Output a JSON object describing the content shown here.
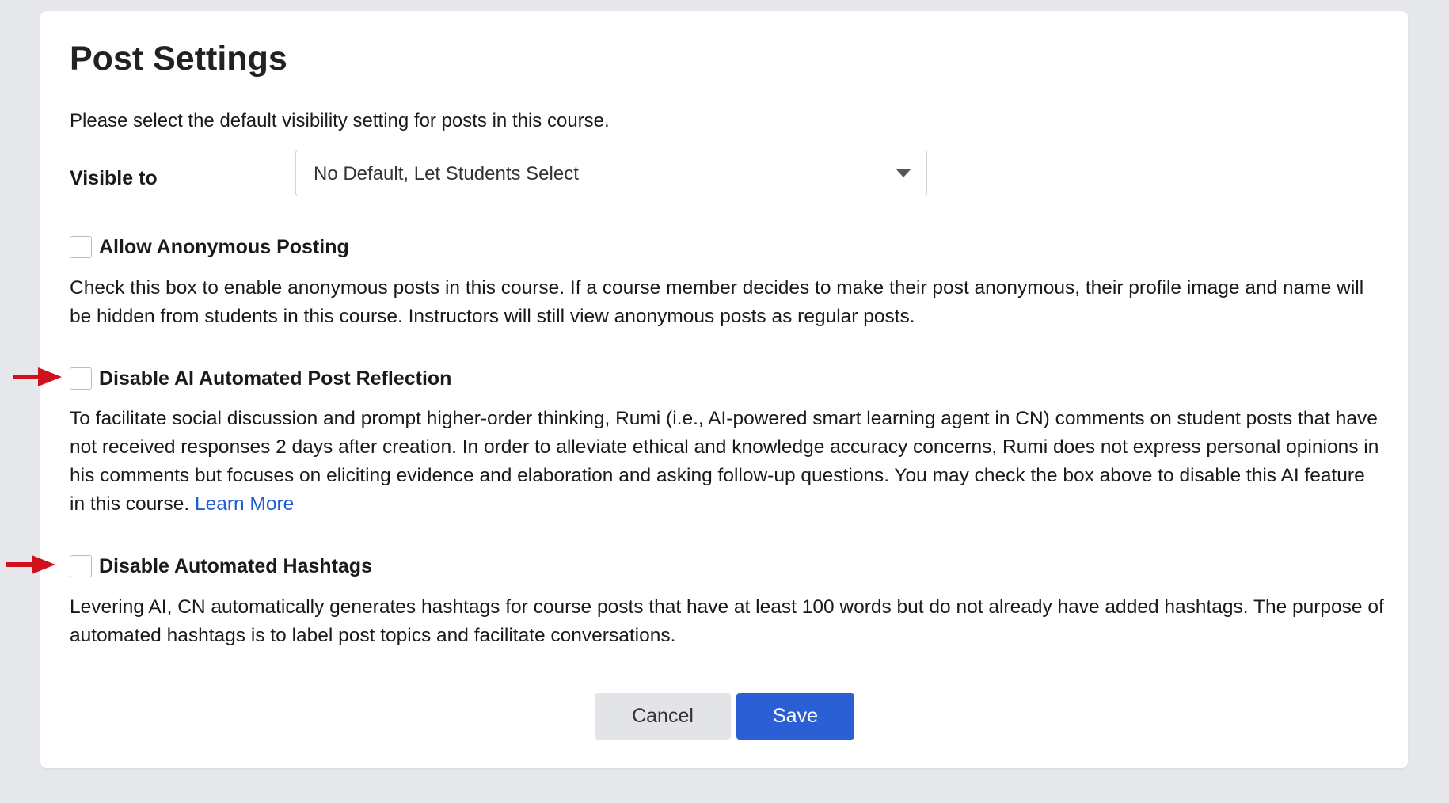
{
  "dialog": {
    "title": "Post Settings",
    "intro": "Please select the default visibility setting for posts in this course."
  },
  "visibility": {
    "label": "Visible to",
    "selected": "No Default, Let Students Select"
  },
  "options": [
    {
      "label": "Allow Anonymous Posting",
      "checked": false,
      "description": "Check this box to enable anonymous posts in this course. If a course member decides to make their post anonymous, their profile image and name will be hidden from students in this course. Instructors will still view anonymous posts as regular posts."
    },
    {
      "label": "Disable AI Automated Post Reflection",
      "checked": false,
      "description": "To facilitate social discussion and prompt higher-order thinking, Rumi (i.e., AI-powered smart learning agent in CN) comments on student posts that have not received responses 2 days after creation. In order to alleviate ethical and knowledge accuracy concerns, Rumi does not express personal opinions in his comments but focuses on eliciting evidence and elaboration and asking follow-up questions. You may check the box above to disable this AI feature in this course.",
      "link": "Learn More"
    },
    {
      "label": "Disable Automated Hashtags",
      "checked": false,
      "description": "Levering AI, CN automatically generates hashtags for course posts that have at least 100 words but do not already have added hashtags. The purpose of automated hashtags is to label post topics and facilitate conversations."
    }
  ],
  "buttons": {
    "cancel": "Cancel",
    "save": "Save"
  },
  "colors": {
    "page_background": "#e5e7eb",
    "card_background": "#ffffff",
    "link": "#1f5fd1",
    "save_button": "#2a5fd6",
    "cancel_button": "#e2e4e7",
    "annotation_arrow": "#d0101b"
  },
  "icons": {
    "dropdown": "caret-down-icon",
    "annotation": "red-arrow-icon"
  }
}
